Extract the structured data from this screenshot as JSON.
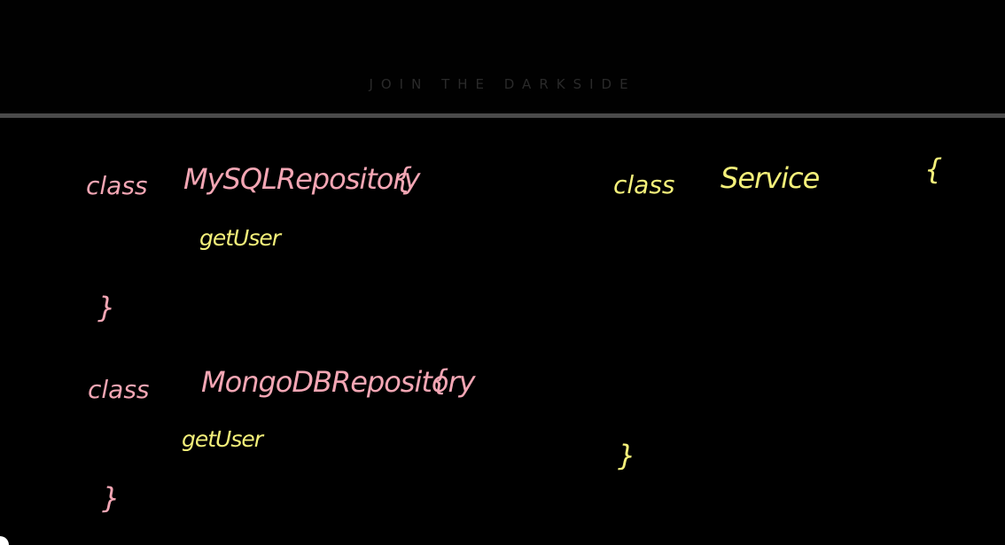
{
  "banner": {
    "text": "JOIN THE DARKSIDE"
  },
  "whiteboard": {
    "left_column": [
      {
        "keyword": "class",
        "name": "MySQLRepository",
        "open_brace": "{",
        "method": "getUser",
        "close_brace": "}"
      },
      {
        "keyword": "class",
        "name": "MongoDBRepository",
        "open_brace": "{",
        "method": "getUser",
        "close_brace": "}"
      }
    ],
    "right_column": {
      "keyword": "class",
      "name": "Service",
      "open_brace": "{",
      "close_brace": "}"
    }
  },
  "colors": {
    "background": "#000000",
    "pink_ink": "#f3a6b4",
    "yellow_ink": "#f4f07a",
    "divider": "#4a4a4a"
  }
}
